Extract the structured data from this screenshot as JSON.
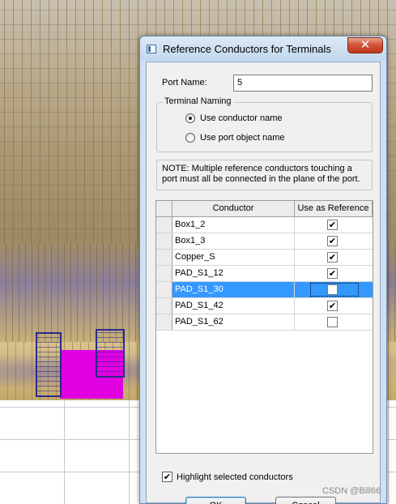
{
  "dialog": {
    "title": "Reference Conductors for Terminals",
    "close_label": "✕",
    "port_name_label": "Port Name:",
    "port_name_value": "5",
    "terminal_naming": {
      "legend": "Terminal Naming",
      "options": [
        {
          "label": "Use conductor name",
          "selected": true
        },
        {
          "label": "Use port object name",
          "selected": false
        }
      ]
    },
    "note": "NOTE: Multiple reference conductors touching a port must all be connected in the plane of the port.",
    "table": {
      "columns": [
        "Conductor",
        "Use as Reference"
      ],
      "rows": [
        {
          "conductor": "Box1_2",
          "use_as_reference": true,
          "check_mark": "✔",
          "selected": false
        },
        {
          "conductor": "Box1_3",
          "use_as_reference": true,
          "check_mark": "✔",
          "selected": false
        },
        {
          "conductor": "Copper_S",
          "use_as_reference": true,
          "check_mark": "✔",
          "selected": false
        },
        {
          "conductor": "PAD_S1_12",
          "use_as_reference": true,
          "check_mark": "✔",
          "selected": false
        },
        {
          "conductor": "PAD_S1_30",
          "use_as_reference": false,
          "check_mark": "",
          "selected": true
        },
        {
          "conductor": "PAD_S1_42",
          "use_as_reference": true,
          "check_mark": "✔",
          "selected": false
        },
        {
          "conductor": "PAD_S1_62",
          "use_as_reference": false,
          "check_mark": "",
          "selected": false
        }
      ]
    },
    "highlight_label": "Highlight selected conductors",
    "highlight_checked": true,
    "highlight_mark": "✔",
    "ok_label": "OK",
    "cancel_label": "Cancel"
  },
  "watermark": "CSDN @Bill66",
  "colors": {
    "selection": "#3399ff",
    "pad_highlight": "#e000e0",
    "close_button": "#c4361b"
  }
}
